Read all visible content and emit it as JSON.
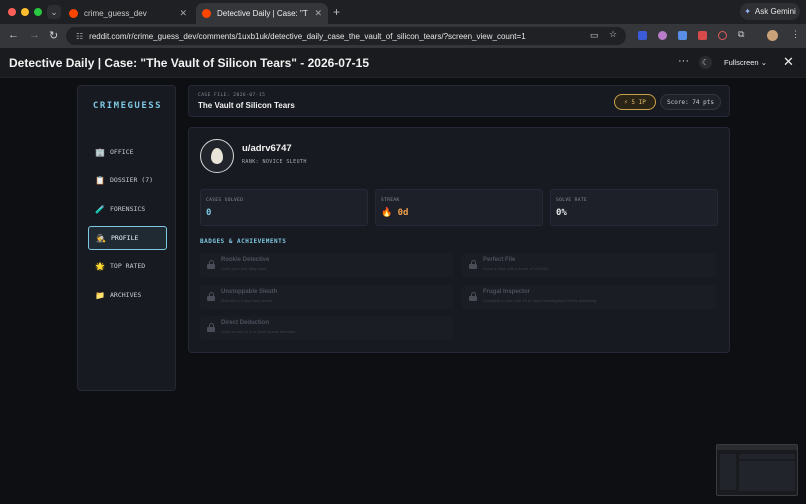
{
  "browser": {
    "tabs": [
      {
        "label": "crime_guess_dev",
        "close": "✕"
      },
      {
        "label": "Detective Daily | Case: \"The V",
        "close": "✕"
      }
    ],
    "new_tab": "+",
    "ask_button": "Ask Gemini",
    "url": "reddit.com/r/crime_guess_dev/comments/1uxb1uk/detective_daily_case_the_vault_of_silicon_tears/?screen_view_count=1"
  },
  "post": {
    "title": "Detective Daily | Case: \"The Vault of Silicon Tears\" - 2026-07-15",
    "more": "···",
    "fullscreen_label": "Fullscreen",
    "close": "✕"
  },
  "sidebar": {
    "logo": "CRIMEGUESS",
    "items": [
      {
        "label": "OFFICE",
        "icon": "🏢"
      },
      {
        "label": "DOSSIER (7)",
        "icon": "📋"
      },
      {
        "label": "FORENSICS",
        "icon": "🧪"
      },
      {
        "label": "PROFILE",
        "icon": "🕵"
      },
      {
        "label": "TOP RATED",
        "icon": "🌟"
      },
      {
        "label": "ARCHIVES",
        "icon": "📁"
      }
    ],
    "active_item": "PROFILE"
  },
  "case": {
    "file": "CASE FILE: 2026-07-15",
    "title": "The Vault of Silicon Tears",
    "ip": "⚡ 5 IP",
    "score": "Score: 74 pts"
  },
  "profile": {
    "username": "u/adrv6747",
    "rank": "RANK: NOVICE SLEUTH",
    "stats": [
      {
        "label": "CASES SOLVED",
        "value": "0",
        "color": "#7ec8e3"
      },
      {
        "label": "STREAK",
        "value": "🔥 0d",
        "color": "#f0a04b"
      },
      {
        "label": "SOLVE RATE",
        "value": "0%",
        "color": "#e8e8e8"
      }
    ],
    "badges_header": "BADGES & ACHIEVEMENTS",
    "badges": [
      {
        "name": "Rookie Detective",
        "desc": "Solve your first daily case."
      },
      {
        "name": "Perfect File",
        "desc": "Solve a case with a score of 100/100."
      },
      {
        "name": "Unstoppable Sleuth",
        "desc": "Maintain a 3-day case streak."
      },
      {
        "name": "Frugal Inspector",
        "desc": "Complete a case with 40 or more Investigation Points remaining."
      },
      {
        "name": "Direct Deduction",
        "desc": "Solve a case in 3 or fewer guess attempts."
      }
    ]
  },
  "colors": {
    "accent": "#7ec8e3",
    "gold": "#e7c067",
    "background": "#0e0f13",
    "panel": "#181a21"
  }
}
